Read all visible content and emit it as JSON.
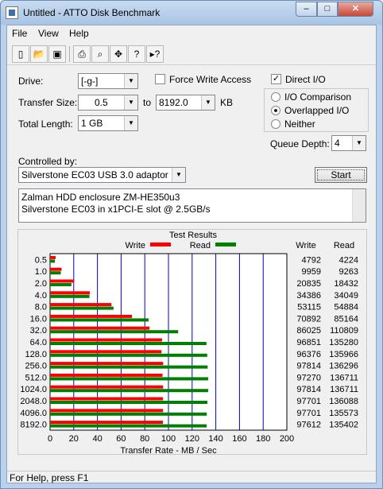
{
  "window": {
    "title": "Untitled - ATTO Disk Benchmark",
    "min": "–",
    "max": "□",
    "close": "✕"
  },
  "menu": [
    "File",
    "View",
    "Help"
  ],
  "toolbar": [
    "new-icon",
    "open-icon",
    "save-icon",
    "print-icon",
    "print-preview-icon",
    "move-icon",
    "help-icon",
    "context-help-icon"
  ],
  "settings": {
    "drive_label": "Drive:",
    "drive_value": "[-g-]",
    "force_write_label": "Force Write Access",
    "force_write_checked": false,
    "direct_io_label": "Direct I/O",
    "direct_io_checked": true,
    "transfer_size_label": "Transfer Size:",
    "transfer_from": "0.5",
    "to_label": "to",
    "transfer_to": "8192.0",
    "unit": "KB",
    "total_length_label": "Total Length:",
    "total_length": "1 GB",
    "io_options": [
      {
        "label": "I/O Comparison",
        "selected": false
      },
      {
        "label": "Overlapped I/O",
        "selected": true
      },
      {
        "label": "Neither",
        "selected": false
      }
    ],
    "queue_depth_label": "Queue Depth:",
    "queue_depth": "4",
    "controlled_by_label": "Controlled by:",
    "controlled_by": "Silverstone EC03 USB 3.0 adaptor",
    "start_label": "Start"
  },
  "description": [
    "Zalman HDD enclosure ZM-HE350u3",
    "Silverstone EC03 in x1PCI-E slot @ 2.5GB/s"
  ],
  "results": {
    "group_title": "Test Results",
    "write_label": "Write",
    "read_label": "Read",
    "col_write": "Write",
    "col_read": "Read"
  },
  "status_text": "For Help, press F1",
  "colors": {
    "write": "#ff0000",
    "read": "#008000",
    "grid": "#0000c0"
  },
  "chart_data": {
    "type": "bar",
    "orientation": "horizontal",
    "categories": [
      "0.5",
      "1.0",
      "2.0",
      "4.0",
      "8.0",
      "16.0",
      "32.0",
      "64.0",
      "128.0",
      "256.0",
      "512.0",
      "1024.0",
      "2048.0",
      "4096.0",
      "8192.0"
    ],
    "series": [
      {
        "name": "Write",
        "values": [
          4792,
          9959,
          20835,
          34386,
          53115,
          70892,
          86025,
          96851,
          96376,
          97814,
          97270,
          97814,
          97701,
          97701,
          97612
        ]
      },
      {
        "name": "Read",
        "values": [
          4224,
          9263,
          18432,
          34049,
          54884,
          85164,
          110809,
          135280,
          135966,
          136296,
          136711,
          136711,
          136088,
          135573,
          135402
        ]
      }
    ],
    "xlabel": "Transfer Rate - MB / Sec",
    "xlim": [
      0,
      200
    ],
    "xticks": [
      "0",
      "20",
      "40",
      "60",
      "80",
      "100",
      "120",
      "140",
      "160",
      "180",
      "200"
    ],
    "grid": true
  }
}
